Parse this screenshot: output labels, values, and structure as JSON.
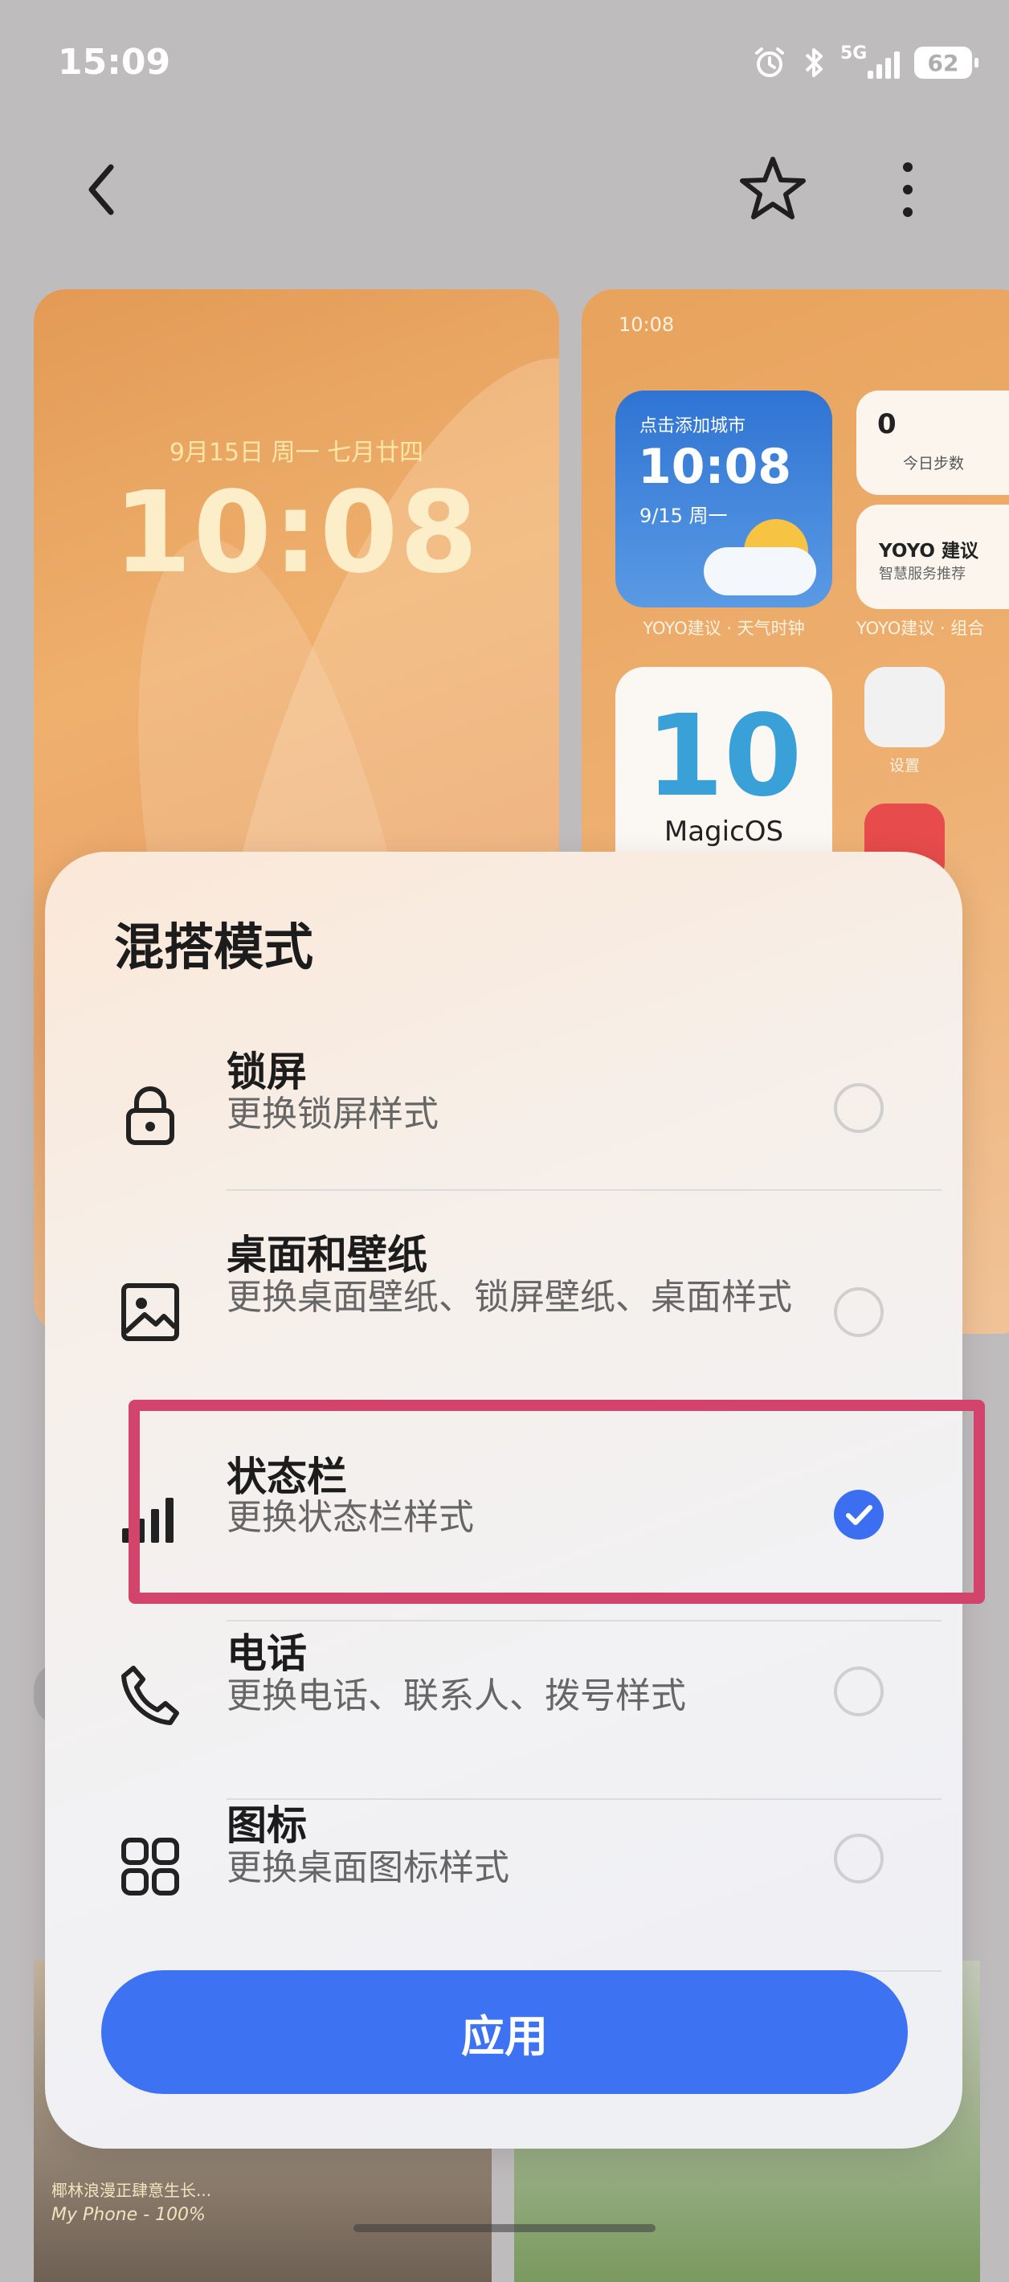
{
  "status_bar": {
    "time": "15:09",
    "network": "5G",
    "battery": "62",
    "icons": [
      "alarm-icon",
      "bluetooth-icon",
      "signal-icon",
      "battery-icon"
    ]
  },
  "app_bar": {
    "icons": [
      "back-icon",
      "star-icon",
      "more-icon"
    ]
  },
  "lock_preview": {
    "date": "9月15日 周一 七月廿四",
    "time": "10:08"
  },
  "home_preview": {
    "time": "10:08",
    "weather_city": "点击添加城市",
    "weather_time": "10:08",
    "weather_date": "9/15 周一",
    "weather_caption": "YOYO建议 · 天气时钟",
    "steps_value": "0",
    "steps_label": "今日步数",
    "yoyo_title": "YOYO 建议",
    "yoyo_sub": "智慧服务推荐",
    "yoyo_caption": "YOYO建议 · 组合",
    "magic_number": "10",
    "magic_label": "MagicOS",
    "settings_label": "设置"
  },
  "background_below": {
    "thumb_text1": "椰林浪漫正肆意生长...",
    "thumb_text2": "My Phone - 100%"
  },
  "sheet": {
    "title": "混搭模式",
    "options": [
      {
        "title": "锁屏",
        "subtitle": "更换锁屏样式",
        "icon": "lock-icon",
        "checked": false
      },
      {
        "title": "桌面和壁纸",
        "subtitle": "更换桌面壁纸、锁屏壁纸、桌面样式",
        "icon": "image-icon",
        "checked": false
      },
      {
        "title": "状态栏",
        "subtitle": "更换状态栏样式",
        "icon": "signal-bars-icon",
        "checked": true
      },
      {
        "title": "电话",
        "subtitle": "更换电话、联系人、拨号样式",
        "icon": "phone-icon",
        "checked": false
      },
      {
        "title": "图标",
        "subtitle": "更换桌面图标样式",
        "icon": "grid-icon",
        "checked": false
      }
    ],
    "apply_label": "应用"
  },
  "colors": {
    "accent": "#3d73f3",
    "highlight": "#d2446c",
    "scrim": "#bfbcbd"
  }
}
